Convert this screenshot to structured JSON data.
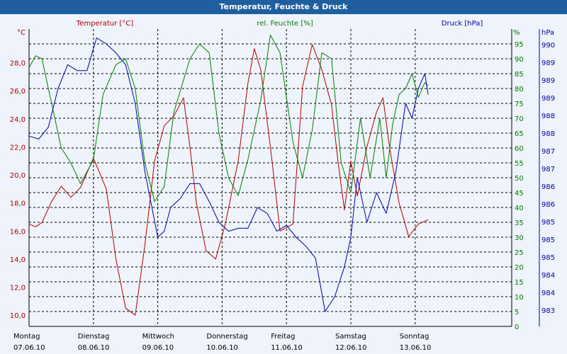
{
  "window": {
    "title": "Temperatur, Feuchte & Druck"
  },
  "colors": {
    "background": "#eef3fc",
    "titlebar": "#1f5fa0",
    "temperature": "#b00000",
    "humidity": "#008000",
    "pressure": "#0000b0",
    "grid": "#000000",
    "text": "#000000"
  },
  "chart_data": {
    "type": "line",
    "series_labels": {
      "temperature": "Temperatur [°C]",
      "humidity": "rel. Feuchte [%]",
      "pressure": "Druck [hPa]"
    },
    "axes": {
      "left": {
        "unit": "°C",
        "range": [
          9.2,
          30.4
        ],
        "ticks": [
          "10,0",
          "12,0",
          "14,0",
          "16,0",
          "18,0",
          "20,0",
          "22,0",
          "24,0",
          "26,0",
          "28,0"
        ],
        "tick_values": [
          10,
          12,
          14,
          16,
          18,
          20,
          22,
          24,
          26,
          28
        ]
      },
      "right_humidity": {
        "unit": "%",
        "range": [
          0,
          100
        ],
        "ticks": [
          "0",
          "5",
          "10",
          "15",
          "20",
          "25",
          "30",
          "35",
          "40",
          "45",
          "50",
          "55",
          "60",
          "65",
          "70",
          "75",
          "80",
          "85",
          "90",
          "95"
        ],
        "tick_values": [
          0,
          5,
          10,
          15,
          20,
          25,
          30,
          35,
          40,
          45,
          50,
          55,
          60,
          65,
          70,
          75,
          80,
          85,
          90,
          95
        ]
      },
      "right_pressure": {
        "unit": "hPa",
        "ticks": [
          "983",
          "984",
          "984",
          "985",
          "985",
          "985",
          "986",
          "986",
          "987",
          "987",
          "988",
          "988",
          "989",
          "989",
          "989",
          "990"
        ]
      },
      "x": {
        "range": [
          0,
          7.5
        ],
        "days": [
          {
            "day": "Montag",
            "date": "07.06.10"
          },
          {
            "day": "Dienstag",
            "date": "08.06.10"
          },
          {
            "day": "Mittwoch",
            "date": "09.06.10"
          },
          {
            "day": "Donnerstag",
            "date": "10.06.10"
          },
          {
            "day": "Freitag",
            "date": "11.06.10"
          },
          {
            "day": "Samstag",
            "date": "12.06.10"
          },
          {
            "day": "Sonntag",
            "date": "13.06.10"
          }
        ]
      }
    },
    "grid": true,
    "series": [
      {
        "key": "temperature",
        "name": "Temperatur [°C]",
        "axis": "left",
        "x": [
          0,
          0.1,
          0.2,
          0.35,
          0.5,
          0.65,
          0.8,
          1.0,
          1.2,
          1.35,
          1.5,
          1.65,
          1.8,
          1.95,
          2.1,
          2.25,
          2.4,
          2.5,
          2.6,
          2.75,
          2.9,
          3.05,
          3.25,
          3.4,
          3.5,
          3.6,
          3.75,
          3.9,
          4.1,
          4.25,
          4.4,
          4.55,
          4.7,
          4.8,
          4.9,
          5.0,
          5.1,
          5.25,
          5.4,
          5.5,
          5.6,
          5.75,
          5.9,
          6.05,
          6.2
        ],
        "y": [
          16.5,
          16.3,
          16.6,
          18.1,
          19.2,
          18.4,
          19.1,
          21.2,
          19.0,
          14.0,
          10.5,
          10.0,
          15.0,
          21.0,
          23.5,
          24.2,
          25.5,
          22.0,
          18.0,
          14.6,
          14.0,
          16.5,
          21.0,
          26.5,
          29.0,
          27.5,
          22.0,
          16.0,
          16.5,
          26.3,
          29.3,
          27.5,
          25.0,
          21.0,
          17.5,
          21.0,
          18.5,
          22.0,
          24.5,
          25.5,
          22.0,
          18.0,
          15.6,
          16.5,
          16.8
        ]
      },
      {
        "key": "humidity",
        "name": "rel. Feuchte [%]",
        "axis": "right_humidity",
        "x": [
          0,
          0.1,
          0.2,
          0.35,
          0.5,
          0.65,
          0.8,
          1.0,
          1.15,
          1.35,
          1.5,
          1.65,
          1.8,
          1.95,
          2.1,
          2.25,
          2.5,
          2.65,
          2.8,
          2.95,
          3.1,
          3.25,
          3.4,
          3.6,
          3.75,
          3.9,
          4.1,
          4.25,
          4.4,
          4.55,
          4.7,
          4.85,
          5.0,
          5.15,
          5.3,
          5.45,
          5.55,
          5.65,
          5.75,
          5.85,
          5.95,
          6.05,
          6.15,
          6.2
        ],
        "y": [
          87,
          91,
          90,
          75,
          60,
          55,
          48,
          56,
          78,
          88,
          90,
          80,
          55,
          42,
          47,
          72,
          90,
          95,
          92,
          65,
          50,
          44,
          56,
          76,
          98,
          92,
          62,
          50,
          66,
          92,
          90,
          55,
          45,
          70,
          50,
          70,
          50,
          68,
          78,
          80,
          85,
          77,
          82,
          81
        ]
      },
      {
        "key": "pressure",
        "name": "Druck [hPa]",
        "axis": "right_humidity",
        "x": [
          0,
          0.15,
          0.3,
          0.45,
          0.6,
          0.75,
          0.9,
          1.05,
          1.2,
          1.35,
          1.5,
          1.65,
          1.8,
          1.9,
          2.0,
          2.1,
          2.2,
          2.35,
          2.5,
          2.65,
          2.8,
          2.95,
          3.1,
          3.25,
          3.4,
          3.55,
          3.7,
          3.85,
          4.0,
          4.15,
          4.3,
          4.45,
          4.6,
          4.75,
          4.9,
          5.0,
          5.1,
          5.25,
          5.4,
          5.55,
          5.7,
          5.85,
          5.95,
          6.05,
          6.15,
          6.2
        ],
        "y": [
          64,
          63,
          67,
          80,
          88,
          86,
          86,
          97,
          95,
          92,
          88,
          75,
          52,
          41,
          30,
          32,
          40,
          43,
          48,
          48,
          42,
          35,
          32,
          33,
          33,
          40,
          38,
          32,
          34,
          30,
          27,
          23,
          5,
          10,
          20,
          30,
          50,
          35,
          45,
          38,
          52,
          75,
          70,
          80,
          85,
          78
        ]
      }
    ]
  }
}
